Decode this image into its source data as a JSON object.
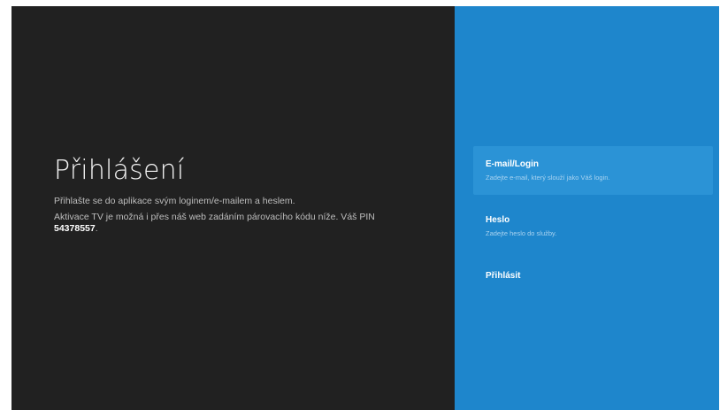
{
  "login": {
    "title": "Přihlášení",
    "description": "Přihlašte se do aplikace svým loginem/e-mailem a heslem.",
    "activation_text": "Aktivace TV je možná i přes náš web zadáním párovacího kódu níže. Váš PIN",
    "pin": "54378557",
    "pin_suffix": "."
  },
  "form": {
    "email_label": "E-mail/Login",
    "email_hint": "Zadejte e-mail, který slouží jako Váš login.",
    "password_label": "Heslo",
    "password_hint": "Zadejte heslo do služby.",
    "submit_label": "Přihlásit"
  },
  "colors": {
    "left_panel": "#212121",
    "right_panel": "#1e86cc",
    "focused_field": "#2b93d6"
  }
}
